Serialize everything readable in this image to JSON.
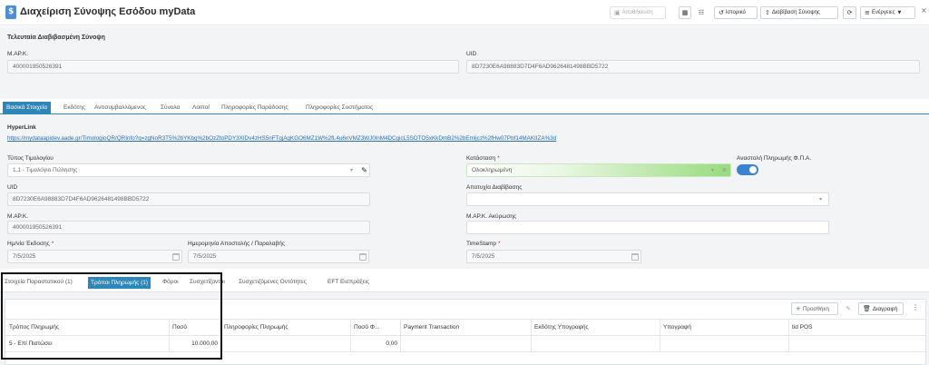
{
  "header": {
    "title": "Διαχείριση Σύνοψης Εσόδου myData",
    "save_label": "Αποθήκευση",
    "history_label": "Ιστορικό",
    "read_summary_label": "Διαβίβαση Σύνοψης",
    "actions_label": "Ενέργειες",
    "close_symbol": "×"
  },
  "last_read": {
    "section_title": "Τελευταία Διαβιβασμένη Σύνοψη",
    "mark_label": "Μ.ΑΡ.Κ.",
    "mark_value": "400001950526391",
    "uid_label": "UID",
    "uid_value": "8D7230E6A98883D7D4F6AD9626481498BBD5722"
  },
  "main_tabs": [
    {
      "label": "Βασικά Στοιχεία"
    },
    {
      "label": "Εκδότης"
    },
    {
      "label": "Αντισυμβαλλόμενος"
    },
    {
      "label": "Σύνολα"
    },
    {
      "label": "Λοιποί"
    },
    {
      "label": "Πληροφορίες Παράδοσης"
    },
    {
      "label": "Πληροφορίες Συστήματος"
    }
  ],
  "basic": {
    "hyperlink_label": "HyperLink",
    "hyperlink_value": "https://mydataapidev.aade.gr/TimologioQR/QRInfo?q=zgNoR3T5%2bYKbg%2bOzZtoPDY3XIDv4zHS5nFTqjAgKGO6MZ1W%2fL4u6nVMZ3WJ0lnM4DCgicL5SOTO5xKkDmB2%2bEmljcz%2fHw07Pbf14MAKIIZA%3d",
    "invoice_type_label": "Τύπος Τιμολογίου",
    "invoice_type_value": "1.1 - Τιμολόγιο Πώλησης",
    "status_label": "Κατάσταση",
    "status_value": "Ολοκληρωμένη",
    "vat_suspend_label": "Αναστολή Πληρωμής Φ.Π.Α.",
    "uid_label": "UID",
    "uid_value": "8D7230E6A98883D7D4F6AD9626481498BBD5722",
    "read_failure_label": "Αποτυχία Διαβίβασης",
    "read_failure_value": "",
    "mark_label": "Μ.ΑΡ.Κ.",
    "mark_value": "400001950526391",
    "cancel_mark_label": "Μ.ΑΡ.Κ. Ακύρωσης",
    "cancel_mark_value": "",
    "issue_date_label": "Ημ/νία Έκδοσης",
    "issue_date_value": "7/5/2025",
    "send_date_label": "Ημερομηνία Αποστολής / Παραλαβής",
    "send_date_value": "7/5/2025",
    "timestamp_label": "TimeStamp",
    "timestamp_value": "7/5/2025",
    "required_mark": "*"
  },
  "bottom_tabs": [
    {
      "label": "Στοιχεία Παραστατικού (1)"
    },
    {
      "label": "Τρόποι Πληρωμής (1)"
    },
    {
      "label": "Φόροι"
    },
    {
      "label": "Συσχετίζονται"
    },
    {
      "label": "Συσχετιζόμενες Οντότητες"
    },
    {
      "label": "EFT Εισπράξεις"
    }
  ],
  "grid": {
    "add_label": "Προσθήκη",
    "delete_label": "Διαγραφή",
    "columns": [
      "Τρόπος Πληρωμής",
      "Ποσό",
      "Πληροφορίες Πληρωμής",
      "Ποσό Φ...",
      "Payment Transaction",
      "Εκδότης Υπογραφής",
      "Υπογραφή",
      "tid POS"
    ],
    "rows": [
      [
        "5 - Επί Πιστώσει",
        "10.000,00",
        "",
        "0,00",
        "",
        "",
        "",
        ""
      ]
    ]
  }
}
